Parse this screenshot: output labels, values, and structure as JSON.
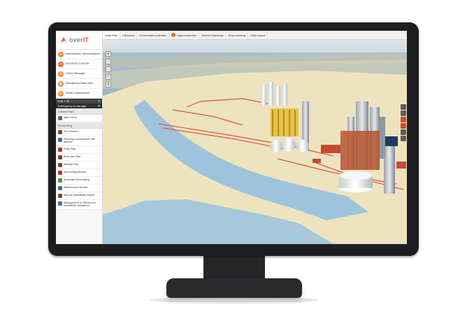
{
  "app": {
    "logo_prefix": "over",
    "logo_suffix": "IT"
  },
  "sidebar": {
    "user": {
      "name": "Administrator Administrators",
      "datetime": "1/21/2022 11:00:00"
    },
    "message": "1 New Message",
    "operational_view": "Operational Data View",
    "collaboration": "Virtual collaboration",
    "status_bar": "Edit + Sh",
    "emergency": "Emergency to manage",
    "current_path_title": "Current Path",
    "main_menu": "Main menu",
    "scheduling_title": "Scheduling",
    "menu_items": [
      {
        "label": "WO Monitor",
        "icon": "monitor-icon"
      },
      {
        "label": "Planning Construction Site Monitor",
        "icon": "construction-icon"
      },
      {
        "label": "Daily Plan",
        "icon": "calendar-icon"
      },
      {
        "label": "Multi-day Plan",
        "icon": "calendar-multi-icon"
      },
      {
        "label": "Weekly Plan",
        "icon": "calendar-week-icon"
      },
      {
        "label": "Accounting Monitor",
        "icon": "accounting-icon"
      },
      {
        "label": "Automatic Scheduling",
        "icon": "automation-icon"
      },
      {
        "label": "Warehouses Monitor",
        "icon": "warehouse-icon"
      },
      {
        "label": "Manual Workability Report",
        "icon": "report-icon"
      },
      {
        "label": "Management of Resources Availability Validations",
        "icon": "resources-icon"
      }
    ]
  },
  "tabs": [
    {
      "label": "Daily Plan",
      "active": true
    },
    {
      "label": "Clipboard"
    },
    {
      "label": "Schedulable Activities"
    },
    {
      "label": "Urgent activities",
      "badge": "1"
    },
    {
      "label": "Search Plannings"
    },
    {
      "label": "Reprocessing"
    },
    {
      "label": "Daily Import"
    }
  ],
  "colors": {
    "accent": "#e4572e",
    "water": "#8fb3cf",
    "land": "#ede3bf",
    "pipe": "#d9563c"
  }
}
